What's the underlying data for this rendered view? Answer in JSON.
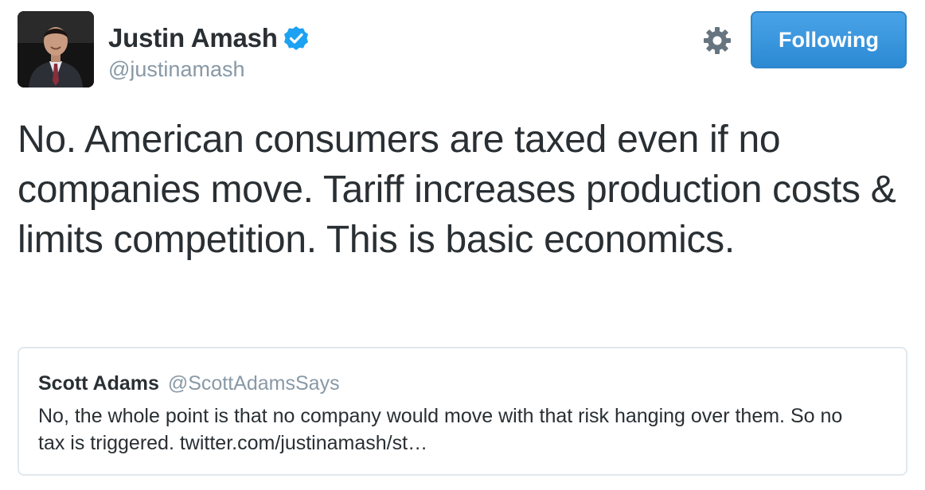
{
  "author": {
    "display_name": "Justin Amash",
    "handle": "@justinamash",
    "verified": true,
    "avatar_icon": "profile-photo"
  },
  "actions": {
    "settings_icon": "gear-icon",
    "follow_label": "Following"
  },
  "tweet": {
    "text": "No. American consumers are taxed even if no companies move. Tariff increases production costs & limits competition. This is basic economics."
  },
  "quoted_tweet": {
    "display_name": "Scott Adams",
    "handle": "@ScottAdamsSays",
    "text": "No, the whole point is that no company would move with that risk hanging over them. So no tax is triggered. twitter.com/justinamash/st…"
  },
  "colors": {
    "primary_text": "#292f33",
    "secondary_text": "#8899a6",
    "button_blue": "#3b94d9",
    "verified_blue": "#1da1f2",
    "card_border": "#e1e8ed"
  }
}
